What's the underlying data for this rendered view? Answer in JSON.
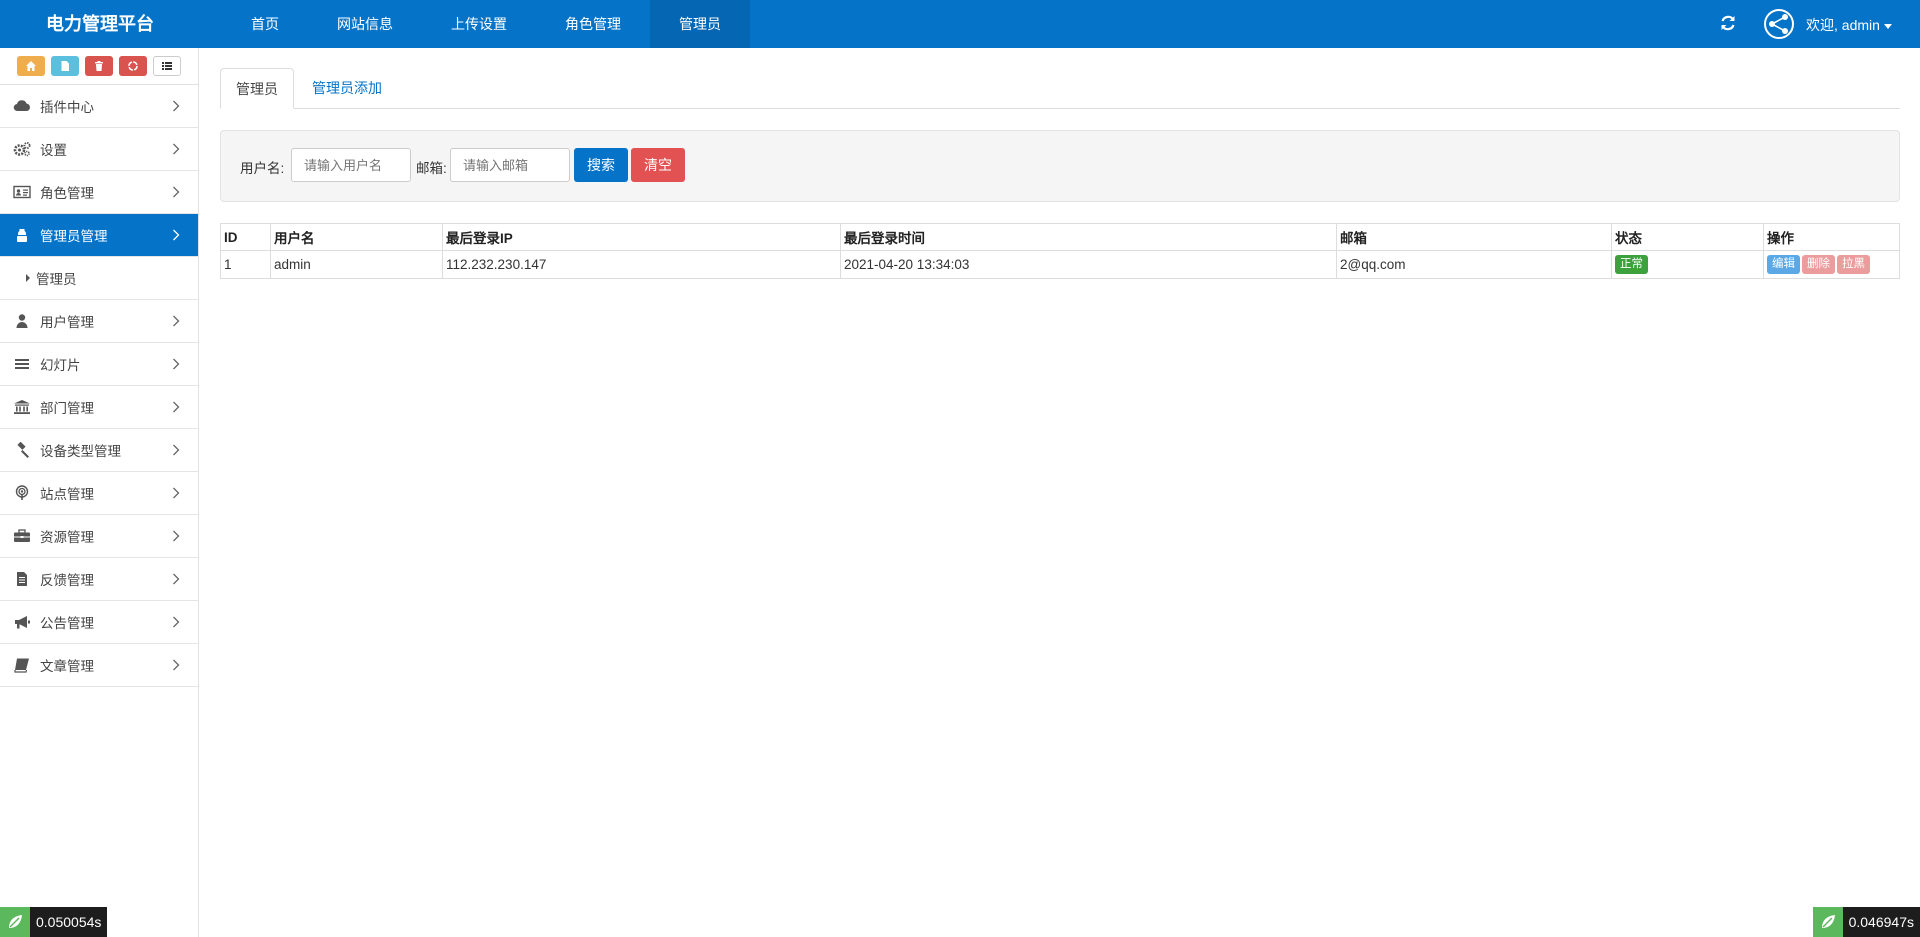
{
  "header": {
    "brand": "电力管理平台",
    "nav": [
      "首页",
      "网站信息",
      "上传设置",
      "角色管理",
      "管理员"
    ],
    "welcome": "欢迎, admin",
    "colors": {
      "primary": "#0574c8",
      "primary_dark": "#0567b3"
    }
  },
  "sidebar": {
    "shortcut_icons": [
      "home-icon",
      "file-icon",
      "trash-icon",
      "recycle-icon",
      "list-icon"
    ],
    "items": [
      {
        "label": "插件中心",
        "icon": "cloud-icon"
      },
      {
        "label": "设置",
        "icon": "gears-icon"
      },
      {
        "label": "角色管理",
        "icon": "id-card-icon"
      },
      {
        "label": "管理员管理",
        "icon": "admin-icon"
      },
      {
        "label": "用户管理",
        "icon": "user-icon"
      },
      {
        "label": "幻灯片",
        "icon": "bars-icon"
      },
      {
        "label": "部门管理",
        "icon": "institution-icon"
      },
      {
        "label": "设备类型管理",
        "icon": "gavel-icon"
      },
      {
        "label": "站点管理",
        "icon": "podcast-icon"
      },
      {
        "label": "资源管理",
        "icon": "briefcase-icon"
      },
      {
        "label": "反馈管理",
        "icon": "file-text-icon"
      },
      {
        "label": "公告管理",
        "icon": "bullhorn-icon"
      },
      {
        "label": "文章管理",
        "icon": "book-icon"
      }
    ],
    "submenu": {
      "label": "管理员"
    }
  },
  "main": {
    "tabs": [
      "管理员",
      "管理员添加"
    ],
    "search": {
      "username_label": "用户名:",
      "username_placeholder": "请输入用户名",
      "email_label": "邮箱:",
      "email_placeholder": "请输入邮箱",
      "search_btn": "搜索",
      "clear_btn": "清空"
    },
    "table": {
      "columns": [
        "ID",
        "用户名",
        "最后登录IP",
        "最后登录时间",
        "邮箱",
        "状态",
        "操作"
      ],
      "rows": [
        {
          "id": "1",
          "username": "admin",
          "ip": "112.232.230.147",
          "time": "2021-04-20 13:34:03",
          "email": "2@qq.com",
          "status": "正常",
          "actions": [
            "编辑",
            "删除",
            "拉黑"
          ]
        }
      ]
    }
  },
  "debug": {
    "left_time": "0.050054s",
    "right_time": "0.046947s"
  }
}
